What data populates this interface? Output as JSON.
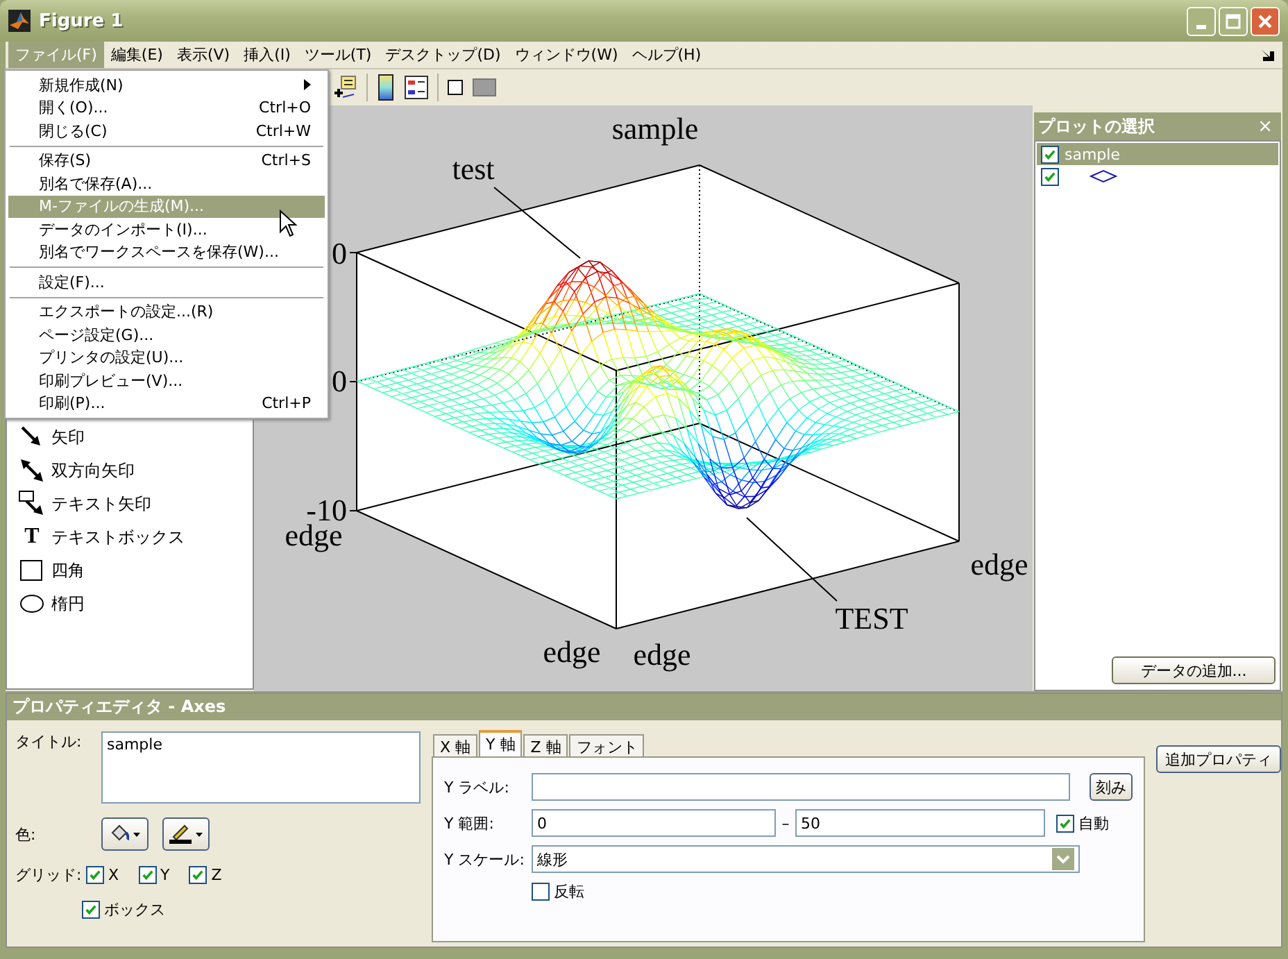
{
  "window": {
    "title": "Figure 1"
  },
  "menu_bar": [
    {
      "label": "ファイル(F)",
      "selected": true
    },
    {
      "label": "編集(E)",
      "selected": false
    },
    {
      "label": "表示(V)",
      "selected": false
    },
    {
      "label": "挿入(I)",
      "selected": false
    },
    {
      "label": "ツール(T)",
      "selected": false
    },
    {
      "label": "デスクトップ(D)",
      "selected": false
    },
    {
      "label": "ウィンドウ(W)",
      "selected": false
    },
    {
      "label": "ヘルプ(H)",
      "selected": false
    }
  ],
  "file_menu": [
    {
      "kind": "item",
      "label": "新規作成(N)",
      "submenu": true,
      "selected": false
    },
    {
      "kind": "item",
      "label": "開く(O)...",
      "shortcut": "Ctrl+O",
      "submenu": false,
      "selected": false
    },
    {
      "kind": "item",
      "label": "閉じる(C)",
      "shortcut": "Ctrl+W",
      "submenu": false,
      "selected": false
    },
    {
      "kind": "separator"
    },
    {
      "kind": "item",
      "label": "保存(S)",
      "shortcut": "Ctrl+S",
      "submenu": false,
      "selected": false
    },
    {
      "kind": "item",
      "label": "別名で保存(A)...",
      "submenu": false,
      "selected": false
    },
    {
      "kind": "item",
      "label": "M-ファイルの生成(M)...",
      "submenu": false,
      "selected": true
    },
    {
      "kind": "item",
      "label": "データのインポート(I)...",
      "submenu": false,
      "selected": false
    },
    {
      "kind": "item",
      "label": "別名でワークスペースを保存(W)...",
      "submenu": false,
      "selected": false
    },
    {
      "kind": "separator"
    },
    {
      "kind": "item",
      "label": "設定(F)...",
      "submenu": false,
      "selected": false
    },
    {
      "kind": "separator"
    },
    {
      "kind": "item",
      "label": "エクスポートの設定...(R)",
      "submenu": false,
      "selected": false
    },
    {
      "kind": "item",
      "label": "ページ設定(G)...",
      "submenu": false,
      "selected": false
    },
    {
      "kind": "item",
      "label": "プリンタの設定(U)...",
      "submenu": false,
      "selected": false
    },
    {
      "kind": "item",
      "label": "印刷プレビュー(V)...",
      "submenu": false,
      "selected": false
    },
    {
      "kind": "item",
      "label": "印刷(P)...",
      "shortcut": "Ctrl+P",
      "submenu": false,
      "selected": false
    }
  ],
  "palette": [
    {
      "kind": "arrow",
      "label": "矢印"
    },
    {
      "kind": "double_arrow",
      "label": "双方向矢印"
    },
    {
      "kind": "text_arrow",
      "label": "テキスト矢印"
    },
    {
      "kind": "textbox",
      "glyph": "T",
      "label": "テキストボックス"
    },
    {
      "kind": "rectangle",
      "label": "四角"
    },
    {
      "kind": "ellipse",
      "label": "楕円"
    }
  ],
  "plot": {
    "title": "sample",
    "annotations": [
      "test",
      "TEST"
    ],
    "z_ticks": [
      "0",
      "0",
      "-10"
    ],
    "axis_labels": [
      "edge",
      "edge",
      "edge",
      "edge"
    ]
  },
  "plot_browser": {
    "title": "プロットの選択",
    "close": "×",
    "items": [
      {
        "kind": "axes",
        "label": "sample",
        "checked": true,
        "selected": true
      },
      {
        "kind": "surface",
        "checked": true,
        "selected": false
      }
    ],
    "add_button": "データの追加..."
  },
  "property_editor": {
    "title": "プロパティエディタ - Axes",
    "title_label": "タイトル:",
    "title_value": "sample",
    "color_label": "色:",
    "grid_label": "グリッド:",
    "grid": [
      {
        "label": "X",
        "checked": true
      },
      {
        "label": "Y",
        "checked": true
      },
      {
        "label": "Z",
        "checked": true
      }
    ],
    "box": {
      "label": "ボックス",
      "checked": true
    },
    "tabs": [
      {
        "label": "X 軸",
        "selected": false
      },
      {
        "label": "Y 軸",
        "selected": true
      },
      {
        "label": "Z 軸",
        "selected": false
      },
      {
        "label": "フォント",
        "selected": false
      }
    ],
    "y_label": {
      "label": "Y ラベル:"
    },
    "tick_button": "刻み",
    "y_range": {
      "label": "Y 範囲:",
      "min": "0",
      "separator": "–",
      "max": "50",
      "auto": {
        "label": "自動",
        "checked": true
      }
    },
    "y_scale": {
      "label": "Y スケール:",
      "value": "線形"
    },
    "reverse": {
      "label": "反転",
      "checked": false
    },
    "more_button": "追加プロパティ"
  }
}
